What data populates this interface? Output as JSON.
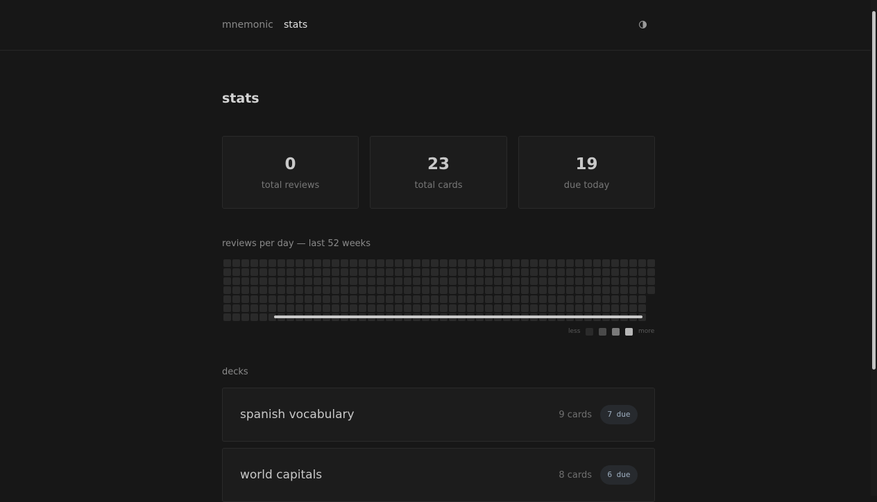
{
  "nav": {
    "brand": "mnemonic",
    "active_link": "stats",
    "theme_icon": "contrast-icon"
  },
  "page": {
    "title": "stats"
  },
  "stats": [
    {
      "value": "0",
      "label": "total reviews"
    },
    {
      "value": "23",
      "label": "total cards"
    },
    {
      "value": "19",
      "label": "due today"
    }
  ],
  "heatmap": {
    "label": "reviews per day — last 52 weeks",
    "legend_less": "less",
    "legend_more": "more",
    "legend_colors": [
      "#2a2a2a",
      "#4a4a4a",
      "#7a7a7a",
      "#b8b8b8"
    ],
    "empty_color": "#2a2a2a"
  },
  "decks": {
    "label": "decks",
    "items": [
      {
        "name": "spanish vocabulary",
        "count": "9 cards",
        "due": "7 due"
      },
      {
        "name": "world capitals",
        "count": "8 cards",
        "due": "6 due"
      }
    ]
  }
}
